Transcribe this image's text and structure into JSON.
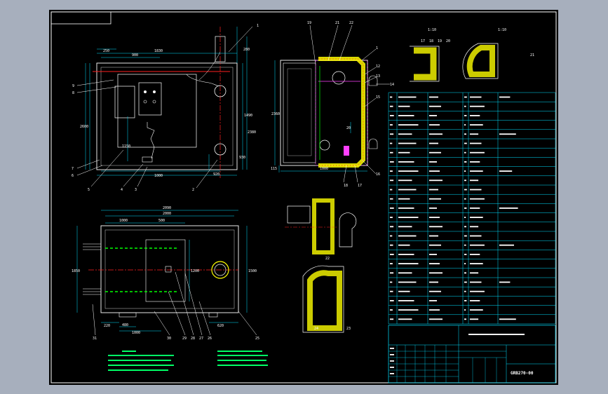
{
  "viewer": {
    "background": "#a7afbd",
    "sheet_color": "#000000"
  },
  "title_block": {
    "drawing_number": "GRB270-00"
  },
  "dimensions": {
    "front": {
      "top_a": "250",
      "top_b": "900",
      "top_c": "1830",
      "right_a": "280",
      "right_b": "1490",
      "right_c": "2380",
      "left_a": "2600",
      "left_b": "1150",
      "bottom_a": "1000",
      "bottom_b": "930",
      "bottom_c": "920"
    },
    "side": {
      "bottom": "1000",
      "height": "2360",
      "left": "115",
      "lower": "20"
    },
    "plan": {
      "top_a": "2090",
      "top_b": "2000",
      "inner_a": "1000",
      "inner_b": "500",
      "left": "1850",
      "right": "1500",
      "inner_v": "1200",
      "bottom_a": "220",
      "bottom_b": "480",
      "bottom_c": "1000",
      "bottom_d": "620"
    }
  },
  "detail_labels": {
    "a": "1:10",
    "b": "1:10"
  },
  "balloons": {
    "front": [
      "9",
      "8",
      "7",
      "6",
      "5",
      "4",
      "3",
      "2",
      "1"
    ],
    "side": [
      "19",
      "21",
      "22",
      "1",
      "12",
      "13",
      "14",
      "15",
      "16",
      "17",
      "18"
    ],
    "plan": [
      "31",
      "30",
      "29",
      "28",
      "27",
      "26",
      "25"
    ],
    "details": [
      "17",
      "18",
      "19",
      "20",
      "21",
      "22",
      "23",
      "24"
    ]
  }
}
